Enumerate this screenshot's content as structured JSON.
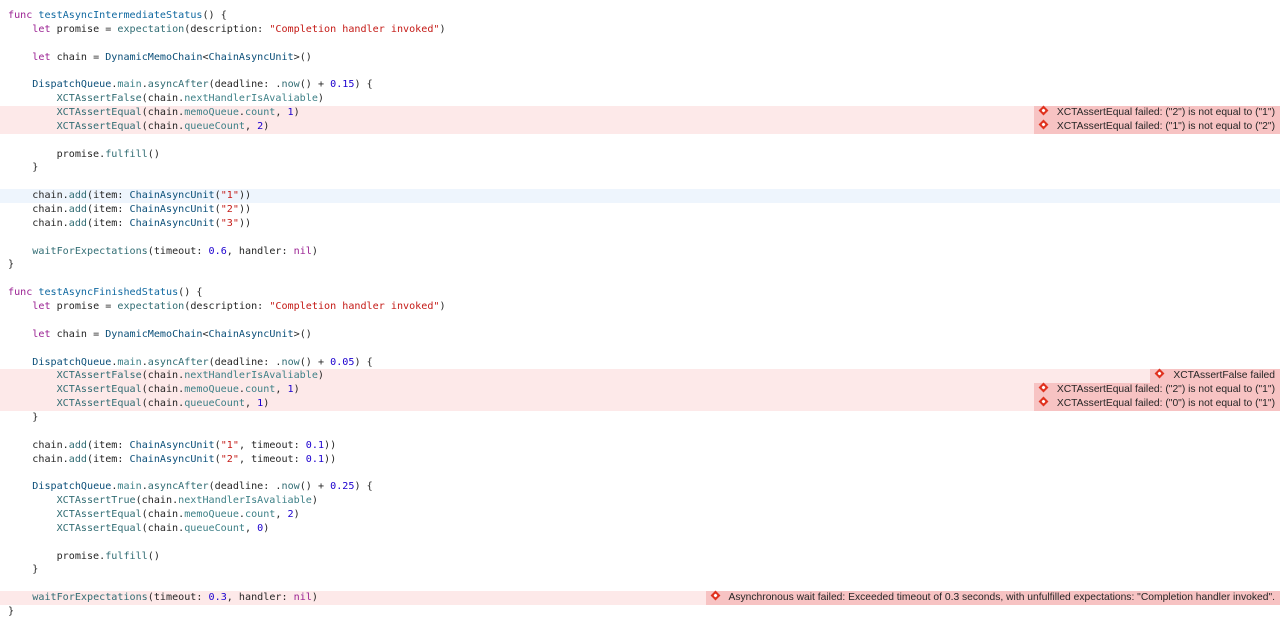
{
  "colors": {
    "background": "#ffffff",
    "error_line": "#fde9e9",
    "current_line": "#eef5fd",
    "error_annotation": "#f7c3c3",
    "error_icon": "#e0321f",
    "keyword": "#9b2393",
    "string": "#c41a16",
    "number": "#1c00cf",
    "function": "#326d74",
    "type": "#0b4f79",
    "declaration": "#0f68a0"
  },
  "lines": [
    {
      "state": "normal",
      "indent": 0,
      "tokens": [
        {
          "t": "kw",
          "v": "func"
        },
        {
          "t": "plain",
          "v": " "
        },
        {
          "t": "decl",
          "v": "testAsyncIntermediateStatus"
        },
        {
          "t": "plain",
          "v": "() {"
        }
      ]
    },
    {
      "state": "normal",
      "indent": 1,
      "tokens": [
        {
          "t": "kw",
          "v": "let"
        },
        {
          "t": "plain",
          "v": " promise = "
        },
        {
          "t": "fn",
          "v": "expectation"
        },
        {
          "t": "plain",
          "v": "(description: "
        },
        {
          "t": "str",
          "v": "\"Completion handler invoked\""
        },
        {
          "t": "plain",
          "v": ")"
        }
      ]
    },
    {
      "state": "normal",
      "indent": 0,
      "tokens": []
    },
    {
      "state": "normal",
      "indent": 1,
      "tokens": [
        {
          "t": "kw",
          "v": "let"
        },
        {
          "t": "plain",
          "v": " chain = "
        },
        {
          "t": "type",
          "v": "DynamicMemoChain"
        },
        {
          "t": "plain",
          "v": "<"
        },
        {
          "t": "type",
          "v": "ChainAsyncUnit"
        },
        {
          "t": "plain",
          "v": ">()"
        }
      ]
    },
    {
      "state": "normal",
      "indent": 0,
      "tokens": []
    },
    {
      "state": "normal",
      "indent": 1,
      "tokens": [
        {
          "t": "type",
          "v": "DispatchQueue"
        },
        {
          "t": "plain",
          "v": "."
        },
        {
          "t": "prop",
          "v": "main"
        },
        {
          "t": "plain",
          "v": "."
        },
        {
          "t": "fn",
          "v": "asyncAfter"
        },
        {
          "t": "plain",
          "v": "(deadline: ."
        },
        {
          "t": "fn",
          "v": "now"
        },
        {
          "t": "plain",
          "v": "() + "
        },
        {
          "t": "num",
          "v": "0.15"
        },
        {
          "t": "plain",
          "v": ") {"
        }
      ]
    },
    {
      "state": "normal",
      "indent": 2,
      "tokens": [
        {
          "t": "fn",
          "v": "XCTAssertFalse"
        },
        {
          "t": "plain",
          "v": "(chain."
        },
        {
          "t": "prop",
          "v": "nextHandlerIsAvaliable"
        },
        {
          "t": "plain",
          "v": ")"
        }
      ]
    },
    {
      "state": "error",
      "indent": 2,
      "tokens": [
        {
          "t": "fn",
          "v": "XCTAssertEqual"
        },
        {
          "t": "plain",
          "v": "(chain."
        },
        {
          "t": "prop",
          "v": "memoQueue"
        },
        {
          "t": "plain",
          "v": "."
        },
        {
          "t": "prop",
          "v": "count"
        },
        {
          "t": "plain",
          "v": ", "
        },
        {
          "t": "num",
          "v": "1"
        },
        {
          "t": "plain",
          "v": ")"
        }
      ],
      "annotation": "XCTAssertEqual failed: (\"2\") is not equal to (\"1\")"
    },
    {
      "state": "error",
      "indent": 2,
      "tokens": [
        {
          "t": "fn",
          "v": "XCTAssertEqual"
        },
        {
          "t": "plain",
          "v": "(chain."
        },
        {
          "t": "prop",
          "v": "queueCount"
        },
        {
          "t": "plain",
          "v": ", "
        },
        {
          "t": "num",
          "v": "2"
        },
        {
          "t": "plain",
          "v": ")"
        }
      ],
      "annotation": "XCTAssertEqual failed: (\"1\") is not equal to (\"2\")"
    },
    {
      "state": "normal",
      "indent": 0,
      "tokens": []
    },
    {
      "state": "normal",
      "indent": 2,
      "tokens": [
        {
          "t": "plain",
          "v": "promise."
        },
        {
          "t": "fn",
          "v": "fulfill"
        },
        {
          "t": "plain",
          "v": "()"
        }
      ]
    },
    {
      "state": "normal",
      "indent": 1,
      "tokens": [
        {
          "t": "plain",
          "v": "}"
        }
      ]
    },
    {
      "state": "normal",
      "indent": 0,
      "tokens": []
    },
    {
      "state": "current",
      "indent": 1,
      "tokens": [
        {
          "t": "plain",
          "v": "chain."
        },
        {
          "t": "fn",
          "v": "add"
        },
        {
          "t": "plain",
          "v": "(item: "
        },
        {
          "t": "type",
          "v": "ChainAsyncUnit"
        },
        {
          "t": "plain",
          "v": "("
        },
        {
          "t": "str",
          "v": "\"1\""
        },
        {
          "t": "plain",
          "v": "))"
        }
      ]
    },
    {
      "state": "normal",
      "indent": 1,
      "tokens": [
        {
          "t": "plain",
          "v": "chain."
        },
        {
          "t": "fn",
          "v": "add"
        },
        {
          "t": "plain",
          "v": "(item: "
        },
        {
          "t": "type",
          "v": "ChainAsyncUnit"
        },
        {
          "t": "plain",
          "v": "("
        },
        {
          "t": "str",
          "v": "\"2\""
        },
        {
          "t": "plain",
          "v": "))"
        }
      ]
    },
    {
      "state": "normal",
      "indent": 1,
      "tokens": [
        {
          "t": "plain",
          "v": "chain."
        },
        {
          "t": "fn",
          "v": "add"
        },
        {
          "t": "plain",
          "v": "(item: "
        },
        {
          "t": "type",
          "v": "ChainAsyncUnit"
        },
        {
          "t": "plain",
          "v": "("
        },
        {
          "t": "str",
          "v": "\"3\""
        },
        {
          "t": "plain",
          "v": "))"
        }
      ]
    },
    {
      "state": "normal",
      "indent": 0,
      "tokens": []
    },
    {
      "state": "normal",
      "indent": 1,
      "tokens": [
        {
          "t": "fn",
          "v": "waitForExpectations"
        },
        {
          "t": "plain",
          "v": "(timeout: "
        },
        {
          "t": "num",
          "v": "0.6"
        },
        {
          "t": "plain",
          "v": ", handler: "
        },
        {
          "t": "kw",
          "v": "nil"
        },
        {
          "t": "plain",
          "v": ")"
        }
      ]
    },
    {
      "state": "normal",
      "indent": 0,
      "tokens": [
        {
          "t": "plain",
          "v": "}"
        }
      ]
    },
    {
      "state": "normal",
      "indent": 0,
      "tokens": []
    },
    {
      "state": "normal",
      "indent": 0,
      "tokens": [
        {
          "t": "kw",
          "v": "func"
        },
        {
          "t": "plain",
          "v": " "
        },
        {
          "t": "decl",
          "v": "testAsyncFinishedStatus"
        },
        {
          "t": "plain",
          "v": "() {"
        }
      ]
    },
    {
      "state": "normal",
      "indent": 1,
      "tokens": [
        {
          "t": "kw",
          "v": "let"
        },
        {
          "t": "plain",
          "v": " promise = "
        },
        {
          "t": "fn",
          "v": "expectation"
        },
        {
          "t": "plain",
          "v": "(description: "
        },
        {
          "t": "str",
          "v": "\"Completion handler invoked\""
        },
        {
          "t": "plain",
          "v": ")"
        }
      ]
    },
    {
      "state": "normal",
      "indent": 0,
      "tokens": []
    },
    {
      "state": "normal",
      "indent": 1,
      "tokens": [
        {
          "t": "kw",
          "v": "let"
        },
        {
          "t": "plain",
          "v": " chain = "
        },
        {
          "t": "type",
          "v": "DynamicMemoChain"
        },
        {
          "t": "plain",
          "v": "<"
        },
        {
          "t": "type",
          "v": "ChainAsyncUnit"
        },
        {
          "t": "plain",
          "v": ">()"
        }
      ]
    },
    {
      "state": "normal",
      "indent": 0,
      "tokens": []
    },
    {
      "state": "normal",
      "indent": 1,
      "tokens": [
        {
          "t": "type",
          "v": "DispatchQueue"
        },
        {
          "t": "plain",
          "v": "."
        },
        {
          "t": "prop",
          "v": "main"
        },
        {
          "t": "plain",
          "v": "."
        },
        {
          "t": "fn",
          "v": "asyncAfter"
        },
        {
          "t": "plain",
          "v": "(deadline: ."
        },
        {
          "t": "fn",
          "v": "now"
        },
        {
          "t": "plain",
          "v": "() + "
        },
        {
          "t": "num",
          "v": "0.05"
        },
        {
          "t": "plain",
          "v": ") {"
        }
      ]
    },
    {
      "state": "error",
      "indent": 2,
      "tokens": [
        {
          "t": "fn",
          "v": "XCTAssertFalse"
        },
        {
          "t": "plain",
          "v": "(chain."
        },
        {
          "t": "prop",
          "v": "nextHandlerIsAvaliable"
        },
        {
          "t": "plain",
          "v": ")"
        }
      ],
      "annotation": "XCTAssertFalse failed"
    },
    {
      "state": "error",
      "indent": 2,
      "tokens": [
        {
          "t": "fn",
          "v": "XCTAssertEqual"
        },
        {
          "t": "plain",
          "v": "(chain."
        },
        {
          "t": "prop",
          "v": "memoQueue"
        },
        {
          "t": "plain",
          "v": "."
        },
        {
          "t": "prop",
          "v": "count"
        },
        {
          "t": "plain",
          "v": ", "
        },
        {
          "t": "num",
          "v": "1"
        },
        {
          "t": "plain",
          "v": ")"
        }
      ],
      "annotation": "XCTAssertEqual failed: (\"2\") is not equal to (\"1\")"
    },
    {
      "state": "error",
      "indent": 2,
      "tokens": [
        {
          "t": "fn",
          "v": "XCTAssertEqual"
        },
        {
          "t": "plain",
          "v": "(chain."
        },
        {
          "t": "prop",
          "v": "queueCount"
        },
        {
          "t": "plain",
          "v": ", "
        },
        {
          "t": "num",
          "v": "1"
        },
        {
          "t": "plain",
          "v": ")"
        }
      ],
      "annotation": "XCTAssertEqual failed: (\"0\") is not equal to (\"1\")"
    },
    {
      "state": "normal",
      "indent": 1,
      "tokens": [
        {
          "t": "plain",
          "v": "}"
        }
      ]
    },
    {
      "state": "normal",
      "indent": 0,
      "tokens": []
    },
    {
      "state": "normal",
      "indent": 1,
      "tokens": [
        {
          "t": "plain",
          "v": "chain."
        },
        {
          "t": "fn",
          "v": "add"
        },
        {
          "t": "plain",
          "v": "(item: "
        },
        {
          "t": "type",
          "v": "ChainAsyncUnit"
        },
        {
          "t": "plain",
          "v": "("
        },
        {
          "t": "str",
          "v": "\"1\""
        },
        {
          "t": "plain",
          "v": ", timeout: "
        },
        {
          "t": "num",
          "v": "0.1"
        },
        {
          "t": "plain",
          "v": "))"
        }
      ]
    },
    {
      "state": "normal",
      "indent": 1,
      "tokens": [
        {
          "t": "plain",
          "v": "chain."
        },
        {
          "t": "fn",
          "v": "add"
        },
        {
          "t": "plain",
          "v": "(item: "
        },
        {
          "t": "type",
          "v": "ChainAsyncUnit"
        },
        {
          "t": "plain",
          "v": "("
        },
        {
          "t": "str",
          "v": "\"2\""
        },
        {
          "t": "plain",
          "v": ", timeout: "
        },
        {
          "t": "num",
          "v": "0.1"
        },
        {
          "t": "plain",
          "v": "))"
        }
      ]
    },
    {
      "state": "normal",
      "indent": 0,
      "tokens": []
    },
    {
      "state": "normal",
      "indent": 1,
      "tokens": [
        {
          "t": "type",
          "v": "DispatchQueue"
        },
        {
          "t": "plain",
          "v": "."
        },
        {
          "t": "prop",
          "v": "main"
        },
        {
          "t": "plain",
          "v": "."
        },
        {
          "t": "fn",
          "v": "asyncAfter"
        },
        {
          "t": "plain",
          "v": "(deadline: ."
        },
        {
          "t": "fn",
          "v": "now"
        },
        {
          "t": "plain",
          "v": "() + "
        },
        {
          "t": "num",
          "v": "0.25"
        },
        {
          "t": "plain",
          "v": ") {"
        }
      ]
    },
    {
      "state": "normal",
      "indent": 2,
      "tokens": [
        {
          "t": "fn",
          "v": "XCTAssertTrue"
        },
        {
          "t": "plain",
          "v": "(chain."
        },
        {
          "t": "prop",
          "v": "nextHandlerIsAvaliable"
        },
        {
          "t": "plain",
          "v": ")"
        }
      ]
    },
    {
      "state": "normal",
      "indent": 2,
      "tokens": [
        {
          "t": "fn",
          "v": "XCTAssertEqual"
        },
        {
          "t": "plain",
          "v": "(chain."
        },
        {
          "t": "prop",
          "v": "memoQueue"
        },
        {
          "t": "plain",
          "v": "."
        },
        {
          "t": "prop",
          "v": "count"
        },
        {
          "t": "plain",
          "v": ", "
        },
        {
          "t": "num",
          "v": "2"
        },
        {
          "t": "plain",
          "v": ")"
        }
      ]
    },
    {
      "state": "normal",
      "indent": 2,
      "tokens": [
        {
          "t": "fn",
          "v": "XCTAssertEqual"
        },
        {
          "t": "plain",
          "v": "(chain."
        },
        {
          "t": "prop",
          "v": "queueCount"
        },
        {
          "t": "plain",
          "v": ", "
        },
        {
          "t": "num",
          "v": "0"
        },
        {
          "t": "plain",
          "v": ")"
        }
      ]
    },
    {
      "state": "normal",
      "indent": 0,
      "tokens": []
    },
    {
      "state": "normal",
      "indent": 2,
      "tokens": [
        {
          "t": "plain",
          "v": "promise."
        },
        {
          "t": "fn",
          "v": "fulfill"
        },
        {
          "t": "plain",
          "v": "()"
        }
      ]
    },
    {
      "state": "normal",
      "indent": 1,
      "tokens": [
        {
          "t": "plain",
          "v": "}"
        }
      ]
    },
    {
      "state": "normal",
      "indent": 0,
      "tokens": []
    },
    {
      "state": "error",
      "indent": 1,
      "tokens": [
        {
          "t": "fn",
          "v": "waitForExpectations"
        },
        {
          "t": "plain",
          "v": "(timeout: "
        },
        {
          "t": "num",
          "v": "0.3"
        },
        {
          "t": "plain",
          "v": ", handler: "
        },
        {
          "t": "kw",
          "v": "nil"
        },
        {
          "t": "plain",
          "v": ")"
        }
      ],
      "annotation": "Asynchronous wait failed: Exceeded timeout of 0.3 seconds, with unfulfilled expectations: \"Completion handler invoked\"."
    },
    {
      "state": "normal",
      "indent": 0,
      "tokens": [
        {
          "t": "plain",
          "v": "}"
        }
      ]
    }
  ]
}
